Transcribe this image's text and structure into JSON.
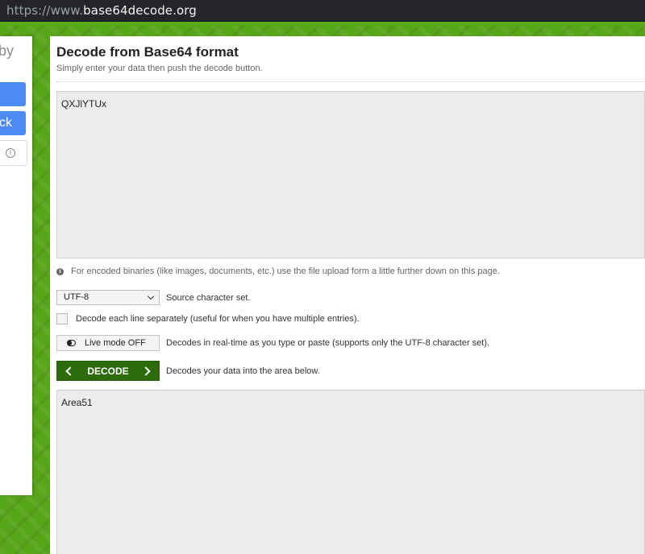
{
  "browser": {
    "url_protocol": "https://www.",
    "url_host": "base64decode.org"
  },
  "left_panel": {
    "partial_text": "by",
    "button_2_partial": "ck",
    "info_icon_glyph": "i"
  },
  "main": {
    "title": "Decode from Base64 format",
    "subtitle": "Simply enter your data then push the decode button.",
    "input_value": "QXJlYTUx",
    "info_text": "For encoded binaries (like images, documents, etc.) use the file upload form a little further down on this page.",
    "charset": {
      "selected": "UTF-8",
      "label": "Source character set."
    },
    "separate_lines": {
      "checked": false,
      "label": "Decode each line separately (useful for when you have multiple entries)."
    },
    "live_mode": {
      "button_label": "Live mode OFF",
      "description": "Decodes in real-time as you type or paste (supports only the UTF-8 character set)."
    },
    "decode": {
      "button_label": "DECODE",
      "description": "Decodes your data into the area below."
    },
    "output_value": "Area51"
  },
  "colors": {
    "background_green": "#57a519",
    "decode_button": "#2e6b0d",
    "blue_button": "#4c8bf5"
  }
}
